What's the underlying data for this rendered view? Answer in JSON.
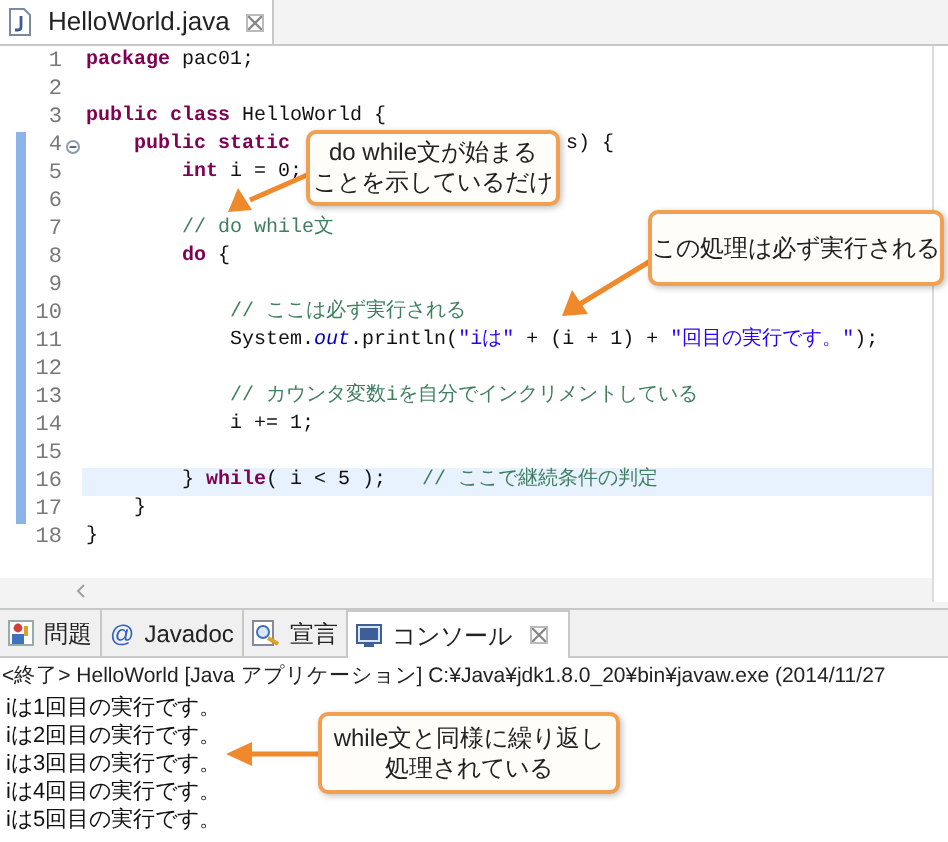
{
  "editor": {
    "tab": {
      "label": "HelloWorld.java",
      "selected": true
    },
    "lines": [
      {
        "number": "1",
        "marked": false,
        "current": false,
        "fold": false,
        "segments": [
          {
            "kind": "keyword",
            "text": "package"
          },
          {
            "kind": "plain",
            "text": " pac01;"
          }
        ]
      },
      {
        "number": "2",
        "marked": false,
        "current": false,
        "fold": false
      },
      {
        "number": "3",
        "marked": false,
        "current": false,
        "fold": false,
        "segments": [
          {
            "kind": "keyword",
            "text": "public class"
          },
          {
            "kind": "plain",
            "text": " HelloWorld {"
          }
        ]
      },
      {
        "number": "4",
        "marked": true,
        "current": false,
        "fold": true,
        "segments": [
          {
            "kind": "keyword",
            "text": "    public static"
          },
          {
            "kind": "after_gap",
            "text": "s) {"
          }
        ]
      },
      {
        "number": "5",
        "marked": true,
        "current": false,
        "fold": false,
        "segments": [
          {
            "kind": "keyword",
            "text": "        int"
          },
          {
            "kind": "plain",
            "text": " i = 0;"
          }
        ]
      },
      {
        "number": "6",
        "marked": true,
        "current": false,
        "fold": false
      },
      {
        "number": "7",
        "marked": true,
        "current": false,
        "fold": false,
        "segments": [
          {
            "kind": "comment",
            "text": "        // do while文"
          }
        ]
      },
      {
        "number": "8",
        "marked": true,
        "current": false,
        "fold": false,
        "segments": [
          {
            "kind": "keyword",
            "text": "        do"
          },
          {
            "kind": "plain",
            "text": " {"
          }
        ]
      },
      {
        "number": "9",
        "marked": true,
        "current": false,
        "fold": false
      },
      {
        "number": "10",
        "marked": true,
        "current": false,
        "fold": false,
        "segments": [
          {
            "kind": "comment",
            "text": "            // ここは必ず実行される"
          }
        ]
      },
      {
        "number": "11",
        "marked": true,
        "current": false,
        "fold": false,
        "segments": [
          {
            "kind": "plain",
            "text": "            System."
          },
          {
            "kind": "field",
            "text": "out"
          },
          {
            "kind": "plain",
            "text": ".println("
          },
          {
            "kind": "string",
            "text": "\"iは\""
          },
          {
            "kind": "plain",
            "text": " + (i + 1) + "
          },
          {
            "kind": "string",
            "text": "\"回目の実行です。\""
          },
          {
            "kind": "plain",
            "text": ");"
          }
        ]
      },
      {
        "number": "12",
        "marked": true,
        "current": false,
        "fold": false
      },
      {
        "number": "13",
        "marked": true,
        "current": false,
        "fold": false,
        "segments": [
          {
            "kind": "comment",
            "text": "            // カウンタ変数iを自分でインクリメントしている"
          }
        ]
      },
      {
        "number": "14",
        "marked": true,
        "current": false,
        "fold": false,
        "segments": [
          {
            "kind": "plain",
            "text": "            i += 1;"
          }
        ]
      },
      {
        "number": "15",
        "marked": true,
        "current": false,
        "fold": false
      },
      {
        "number": "16",
        "marked": true,
        "current": true,
        "fold": false,
        "segments": [
          {
            "kind": "plain",
            "text": "        } "
          },
          {
            "kind": "keyword",
            "text": "while"
          },
          {
            "kind": "plain",
            "text": "( i < 5 );   "
          },
          {
            "kind": "comment",
            "text": "// ここで継続条件の判定"
          }
        ]
      },
      {
        "number": "17",
        "marked": true,
        "current": false,
        "fold": false,
        "segments": [
          {
            "kind": "plain",
            "text": "    }"
          }
        ]
      },
      {
        "number": "18",
        "marked": false,
        "current": false,
        "fold": false,
        "segments": [
          {
            "kind": "plain",
            "text": "}"
          }
        ]
      }
    ]
  },
  "bottom_tabs": [
    {
      "kind": "problems",
      "label": "問題",
      "selected": false
    },
    {
      "kind": "javadoc",
      "icon": "@",
      "label": "Javadoc",
      "selected": false
    },
    {
      "kind": "declaration",
      "label": "宣言",
      "selected": false
    },
    {
      "kind": "console",
      "label": "コンソール",
      "selected": true
    }
  ],
  "console": {
    "header": "<終了> HelloWorld [Java アプリケーション] C:¥Java¥jdk1.8.0_20¥bin¥javaw.exe (2014/11/27",
    "output": [
      "iは1回目の実行です。",
      "iは2回目の実行です。",
      "iは3回目の実行です。",
      "iは4回目の実行です。",
      "iは5回目の実行です。"
    ]
  },
  "callouts": [
    [
      "do while文が始まる",
      "ことを示しているだけ"
    ],
    [
      "この処理は必ず実行される"
    ],
    [
      "while文と同様に繰り返し",
      "処理されている"
    ]
  ]
}
